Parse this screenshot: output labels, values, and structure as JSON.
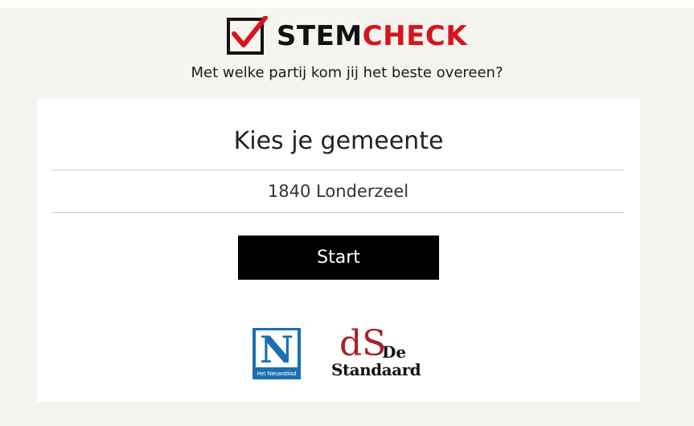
{
  "header": {
    "logo_stem": "STEM",
    "logo_check": "CHECK",
    "logo_icon": "checkbox-check-icon",
    "tagline": "Met welke partij kom jij het beste overeen?"
  },
  "card": {
    "title": "Kies je gemeente",
    "selected_municipality": "1840 Londerzeel",
    "start_label": "Start"
  },
  "partners": {
    "nieuwsblad_letter": "N",
    "nieuwsblad_caption": "Het Nieuwsblad",
    "standaard_mark": "dS",
    "standaard_de": "De",
    "standaard_name": "Standaard"
  },
  "colors": {
    "brand_red": "#d7141e",
    "background": "#f5f4ef",
    "nieuwsblad_blue": "#1b6fb0",
    "standaard_red": "#a6222a"
  }
}
